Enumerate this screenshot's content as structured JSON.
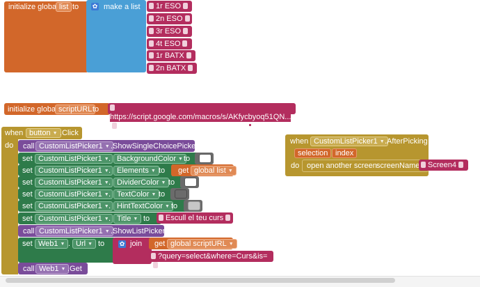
{
  "colors": {
    "variable": "#d2672a",
    "list": "#4a9fd6",
    "text": "#b32d5e",
    "event": "#b7962f",
    "component": "#2e7b4a",
    "method": "#7a4c9a"
  },
  "block1": {
    "init_label": "initialize global",
    "var_name": "list",
    "to_label": "to",
    "make_list_label": "make a list",
    "items": [
      "1r ESO",
      "2n ESO",
      "3r ESO",
      "4t ESO",
      "1r BATX",
      "2n BATX"
    ]
  },
  "block2": {
    "init_label": "initialize global",
    "var_name": "scriptURL",
    "to_label": "to",
    "url": "https://script.google.com/macros/s/AKfycbyoq51QN..."
  },
  "block3": {
    "when_label": "when",
    "component": "button",
    "event": ".Click",
    "do_label": "do",
    "rows": [
      {
        "kind": "call",
        "label": "call",
        "comp": "CustomListPicker1",
        "prop": ".ShowSingleChoicePicker"
      },
      {
        "kind": "set",
        "label": "set",
        "comp": "CustomListPicker1",
        "prop": "BackgroundColor",
        "to": "to",
        "value_type": "swatch",
        "swatch": "#ffffff"
      },
      {
        "kind": "set",
        "label": "set",
        "comp": "CustomListPicker1",
        "prop": "Elements",
        "to": "to",
        "value_type": "get",
        "get_label": "get",
        "get_value": "global list"
      },
      {
        "kind": "set",
        "label": "set",
        "comp": "CustomListPicker1",
        "prop": "DividerColor",
        "to": "to",
        "value_type": "swatch",
        "swatch": "#ffffff"
      },
      {
        "kind": "set",
        "label": "set",
        "comp": "CustomListPicker1",
        "prop": "TextColor",
        "to": "to",
        "value_type": "swatch",
        "swatch": "#6b6b6b"
      },
      {
        "kind": "set",
        "label": "set",
        "comp": "CustomListPicker1",
        "prop": "HintTextColor",
        "to": "to",
        "value_type": "swatch",
        "swatch": "#c6c6c6"
      },
      {
        "kind": "set",
        "label": "set",
        "comp": "CustomListPicker1",
        "prop": "Title",
        "to": "to",
        "value_type": "text",
        "text": "Escull el teu curs"
      },
      {
        "kind": "call",
        "label": "call",
        "comp": "CustomListPicker1",
        "prop": ".ShowListPicker"
      }
    ],
    "web_set": {
      "label": "set",
      "comp": "Web1",
      "prop": "Url",
      "to": "to",
      "join_label": "join",
      "get_label": "get",
      "get_value": "global scriptURL",
      "query": "?query=select&where=Curs&is="
    },
    "web_call": {
      "label": "call",
      "comp": "Web1",
      "method": ".Get"
    }
  },
  "block4": {
    "when_label": "when",
    "component": "CustomListPicker1",
    "event": ".AfterPicking",
    "params": [
      "selection",
      "index"
    ],
    "do_label": "do",
    "open_label": "open another screen",
    "screen_name_label": "screenName",
    "screen_value": "Screen4"
  }
}
